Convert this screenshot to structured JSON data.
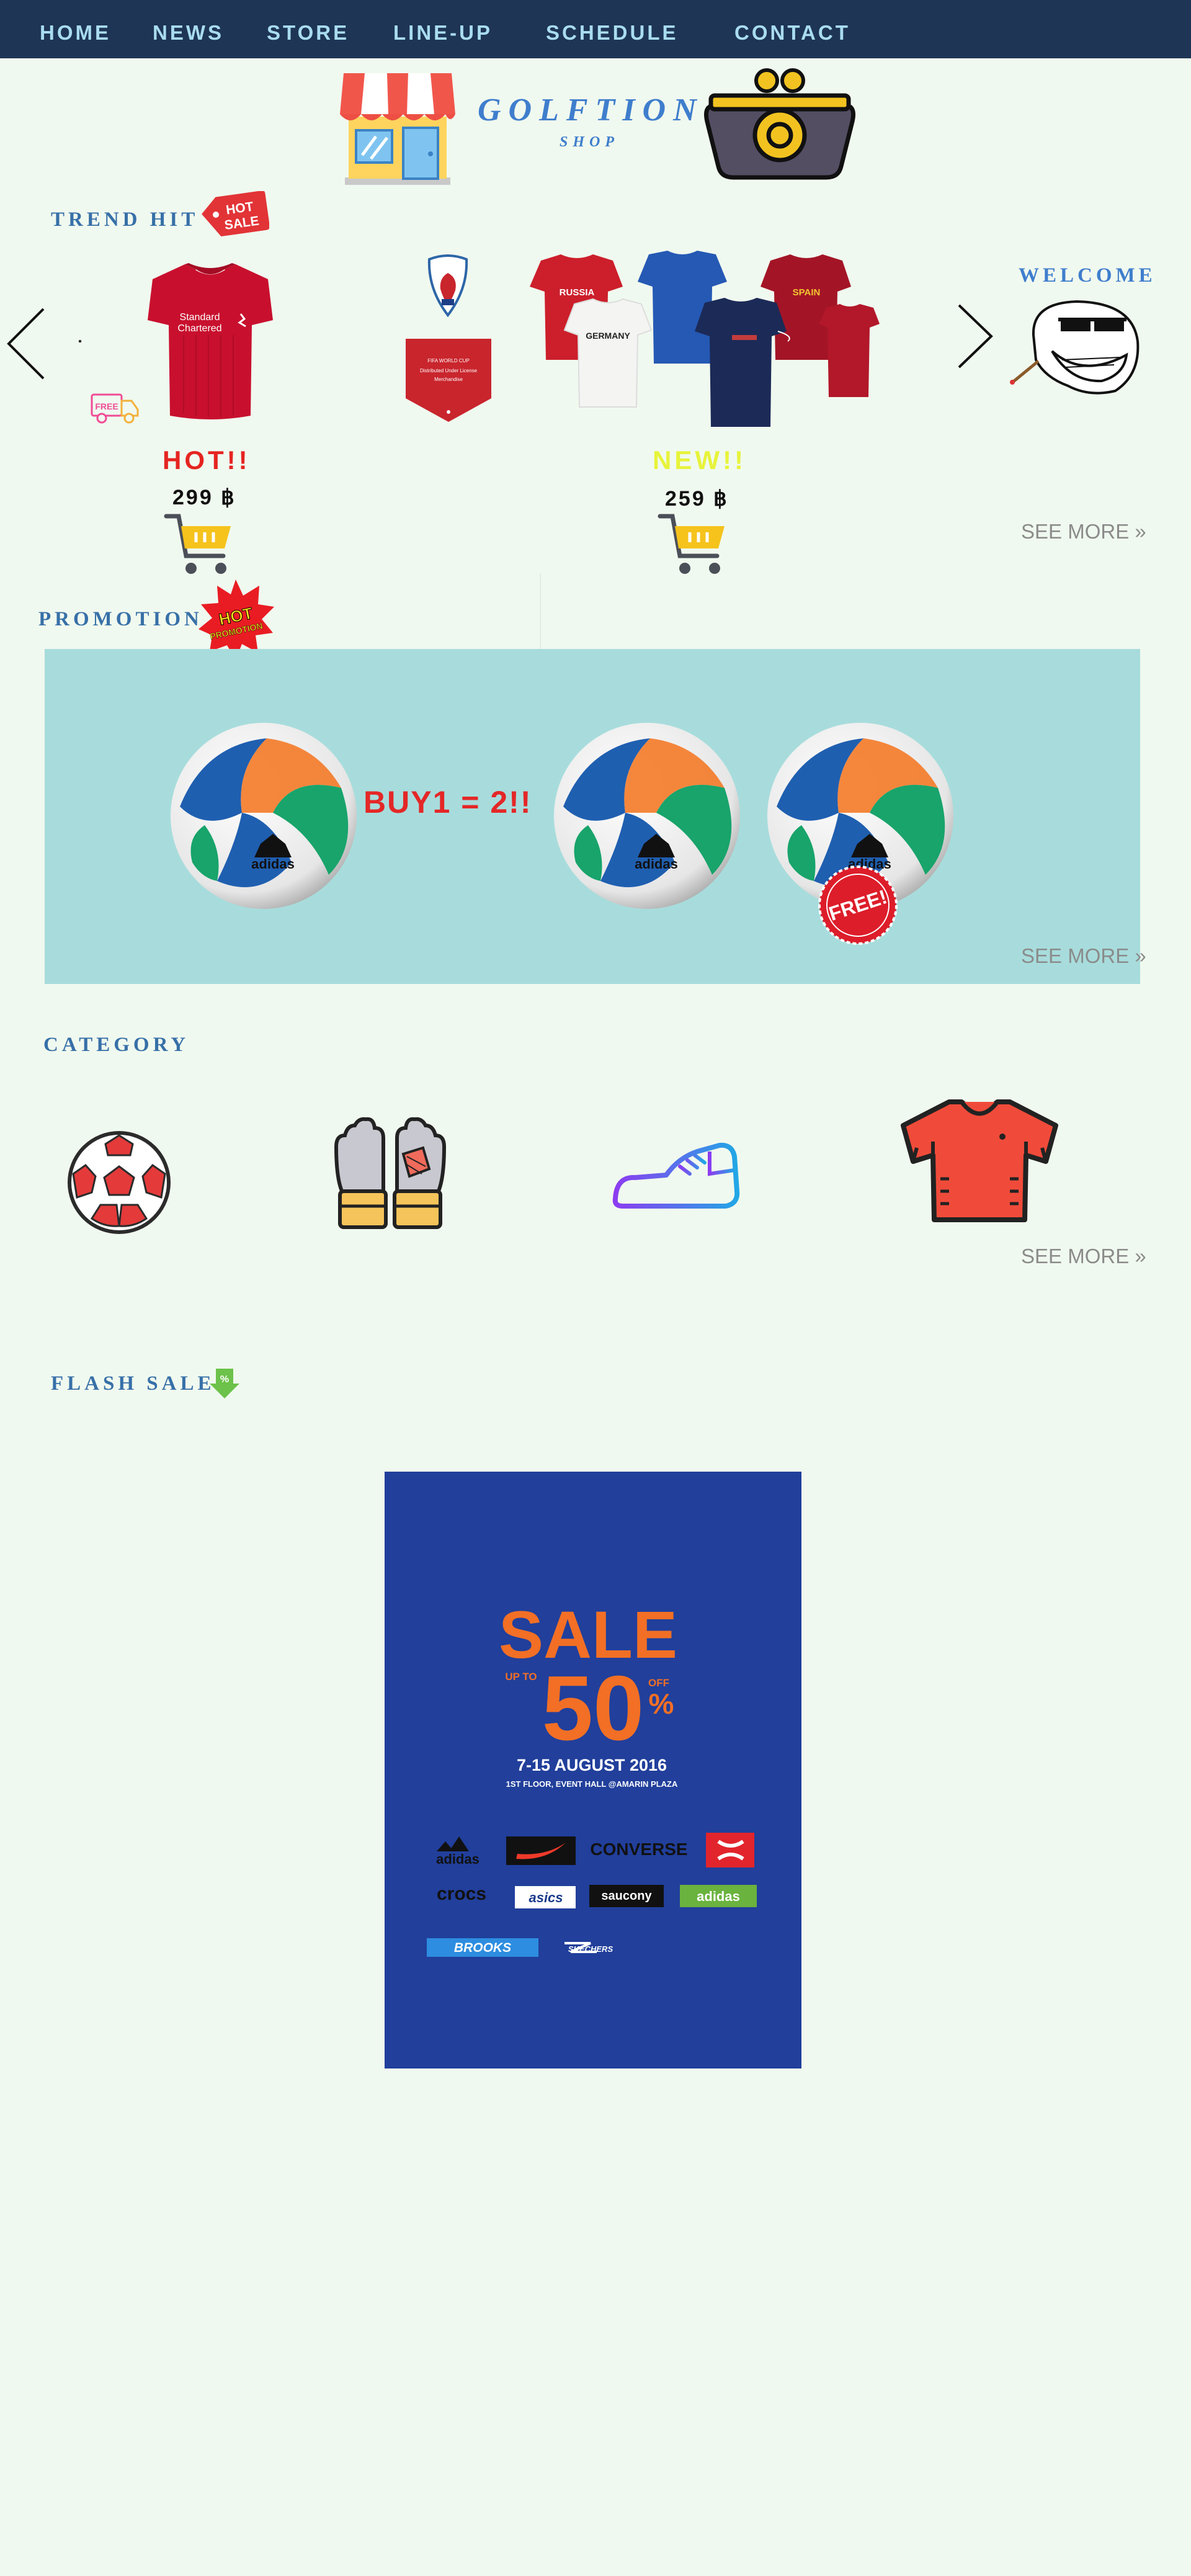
{
  "nav": {
    "items": [
      {
        "label": "HOME",
        "name": "nav-home"
      },
      {
        "label": "NEWS",
        "name": "nav-news"
      },
      {
        "label": "STORE",
        "name": "nav-store"
      },
      {
        "label": "LINE-UP",
        "name": "nav-line-up"
      },
      {
        "label": "SCHEDULE",
        "name": "nav-schedule"
      },
      {
        "label": "CONTACT",
        "name": "nav-contact"
      }
    ]
  },
  "brand": {
    "title": "GOLFTION",
    "subtitle": "SHOP"
  },
  "icons": {
    "store": "storefront-icon",
    "wallet": "coin-purse-icon",
    "prev": "chevron-left-icon",
    "next": "chevron-right-icon",
    "cart": "shopping-cart-icon",
    "delivery": "free-delivery-truck-icon",
    "mascot": "trollface-icon",
    "flash": "discount-arrow-icon"
  },
  "trend": {
    "title": "TREND HIT",
    "badge": [
      "HOT",
      "SALE"
    ],
    "free_label": "FREE",
    "welcome": "WELCOME",
    "products": [
      {
        "tag": "HOT!!",
        "price": "299 ฿",
        "tag_color": "#e52421"
      },
      {
        "tag": "NEW!!",
        "price": "259 ฿",
        "tag_color": "#e7f33a"
      }
    ],
    "jersey_texts": {
      "sponsor": "Standard Chartered",
      "russia": "RUSSIA",
      "germany": "GERMANY",
      "spain": "SPAIN"
    },
    "see_more": "SEE MORE »"
  },
  "promotion": {
    "title": "PROMOTION",
    "badge": [
      "HOT",
      "PROMOTION"
    ],
    "offer": "BUY1 = 2!!",
    "free_stamp": "FREE!",
    "ball_brand": "adidas",
    "see_more": "SEE MORE »"
  },
  "category": {
    "title": "CATEGORY",
    "items": [
      "soccer-ball-icon",
      "goalkeeper-gloves-icon",
      "sneaker-icon",
      "jersey-icon"
    ],
    "see_more": "SEE MORE »"
  },
  "flash_sale": {
    "title": "FLASH SALE",
    "poster": {
      "headline": "SALE",
      "up_to": "UP TO",
      "percent": "50",
      "off": "OFF",
      "percent_sign": "%",
      "dates": "7-15 AUGUST 2016",
      "venue": "1ST FLOOR, EVENT HALL @AMARIN PLAZA",
      "brands": [
        "adidas",
        "NIKE",
        "CONVERSE",
        "UA",
        "crocs",
        "asics",
        "saucony",
        "adidas",
        "BROOKS",
        "SKECHERS"
      ]
    }
  },
  "colors": {
    "background": "#f0f9ef",
    "nav": "#1e3556",
    "promo_panel": "#a8dcdc",
    "poster": "#213f9b",
    "accent": "#3f7ecd"
  }
}
